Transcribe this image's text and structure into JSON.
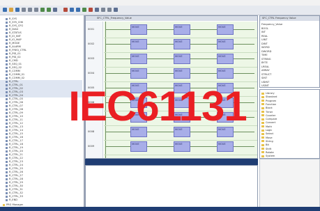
{
  "watermark": "IEC61131",
  "menu": [
    "File",
    "Edit",
    "View",
    "Options",
    "Tools",
    "Window",
    "Help"
  ],
  "colors": {
    "watermark": "#ea1f23",
    "function_block": "#a8aee8",
    "rung_background": "#edf7e6",
    "status_bar": "#1f3d73"
  },
  "tree": {
    "items": [
      "R_SYS",
      "R_SYS_CHK",
      "R_SYS_CFG",
      "R_DIAG",
      "R_STATUS",
      "R_IO_INIT",
      "R_IO_MAP",
      "R_MODE",
      "R_ALARM",
      "R_FREQ_CTRL",
      "R_PID_01",
      "R_PID_02",
      "R_CMD",
      "R_SEQ_01",
      "R_SEQ_02",
      "R_COMM",
      "R_COMM_01",
      "R_COMM_02",
      "R_CTRL",
      "R_CTRL_01",
      "R_CTRL_02",
      "R_CTRL_03",
      "R_CTRL_04",
      "R_CTRL_05",
      "R_CTRL_06",
      "R_CTRL_07",
      "R_CTRL_08",
      "R_CTRL_09",
      "R_CTRL_10",
      "R_CTRL_11",
      "R_CTRL_12",
      "R_CTRL_13",
      "R_CTRL_14",
      "R_CTRL_15",
      "R_CTRL_16",
      "R_CTRL_17",
      "R_CTRL_18",
      "R_CTRL_19",
      "R_CTRL_20",
      "R_CTRL_21",
      "R_CTRL_22",
      "R_CTRL_23",
      "R_CTRL_24",
      "R_CTRL_25",
      "R_CTRL_26",
      "R_CTRL_27",
      "R_CTRL_28",
      "R_CTRL_29",
      "R_CTRL_30",
      "R_CTRL_31",
      "R_CTRL_32",
      "R_CTRL_33",
      "R_END"
    ],
    "bottom_item": "PRG Manager"
  },
  "editor": {
    "tab_label": "SFC_CTRL_Frequency_Value",
    "rungs": [
      {
        "number": "0001",
        "blocks": [
          "MOVE",
          "MOVE",
          "MOVE"
        ]
      },
      {
        "number": "0002",
        "blocks": [
          "MOVE",
          "MOVE",
          "MOVE"
        ]
      },
      {
        "number": "0003",
        "blocks": [
          "MOVE",
          "MOVE",
          "MOVE"
        ]
      },
      {
        "number": "0004",
        "blocks": [
          "MOVE",
          "MOVE",
          "MOVE"
        ]
      },
      {
        "number": "0005",
        "blocks": [
          "MOVE",
          "MOVE",
          "MOVE"
        ]
      },
      {
        "number": "0006",
        "blocks": [
          "MOVE",
          "MOVE",
          "MOVE"
        ]
      },
      {
        "number": "0007",
        "blocks": [
          "MOVE",
          "MOVE",
          "MOVE"
        ]
      },
      {
        "number": "0008",
        "blocks": [
          "MOVE",
          "MOVE",
          "MOVE"
        ]
      },
      {
        "number": "0009",
        "blocks": [
          "MOVE",
          "MOVE",
          "MOVE"
        ]
      }
    ]
  },
  "properties": {
    "header": "SFC_CTRL Frequency Value",
    "rows": [
      "Frequency_Value",
      "BOOL",
      "INT",
      "REAL",
      "UINT",
      "DINT",
      "WORD",
      "DWORD",
      "TIME",
      "STRING",
      "BYTE",
      "LREAL",
      "ARRAY",
      "STRUCT",
      "SINT",
      "UDINT",
      "USINT"
    ]
  },
  "library": {
    "items": [
      "Library",
      "Standard",
      "Program",
      "Function",
      "Block",
      "Timer",
      "Counter",
      "Compare",
      "Convert",
      "Math",
      "Logic",
      "Select",
      "Move",
      "String",
      "Bit",
      "Shift",
      "Rotate",
      "System"
    ]
  }
}
